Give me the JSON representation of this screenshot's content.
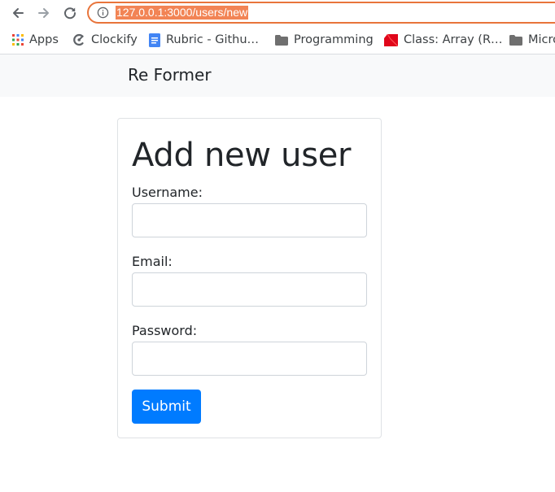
{
  "browser": {
    "url": "127.0.0.1:3000/users/new",
    "icons": [
      "back-icon",
      "forward-icon",
      "reload-icon",
      "info-icon"
    ],
    "accent_color": "#e8743b"
  },
  "bookmarks": [
    {
      "label": "Apps",
      "icon": "apps-grid-icon"
    },
    {
      "label": "Clockify",
      "icon": "clockify-icon"
    },
    {
      "label": "Rubric - Githu…",
      "icon": "document-icon"
    },
    {
      "label": "Programming",
      "icon": "folder-icon"
    },
    {
      "label": "Class: Array (R…",
      "icon": "ruby-icon"
    },
    {
      "label": "Micro",
      "icon": "folder-icon"
    }
  ],
  "navbar": {
    "brand": "Re Former"
  },
  "form": {
    "title": "Add new user",
    "fields": [
      {
        "label": "Username:",
        "value": "",
        "type": "text"
      },
      {
        "label": "Email:",
        "value": "",
        "type": "text"
      },
      {
        "label": "Password:",
        "value": "",
        "type": "password"
      }
    ],
    "submit_label": "Submit",
    "button_color": "#007bff"
  }
}
